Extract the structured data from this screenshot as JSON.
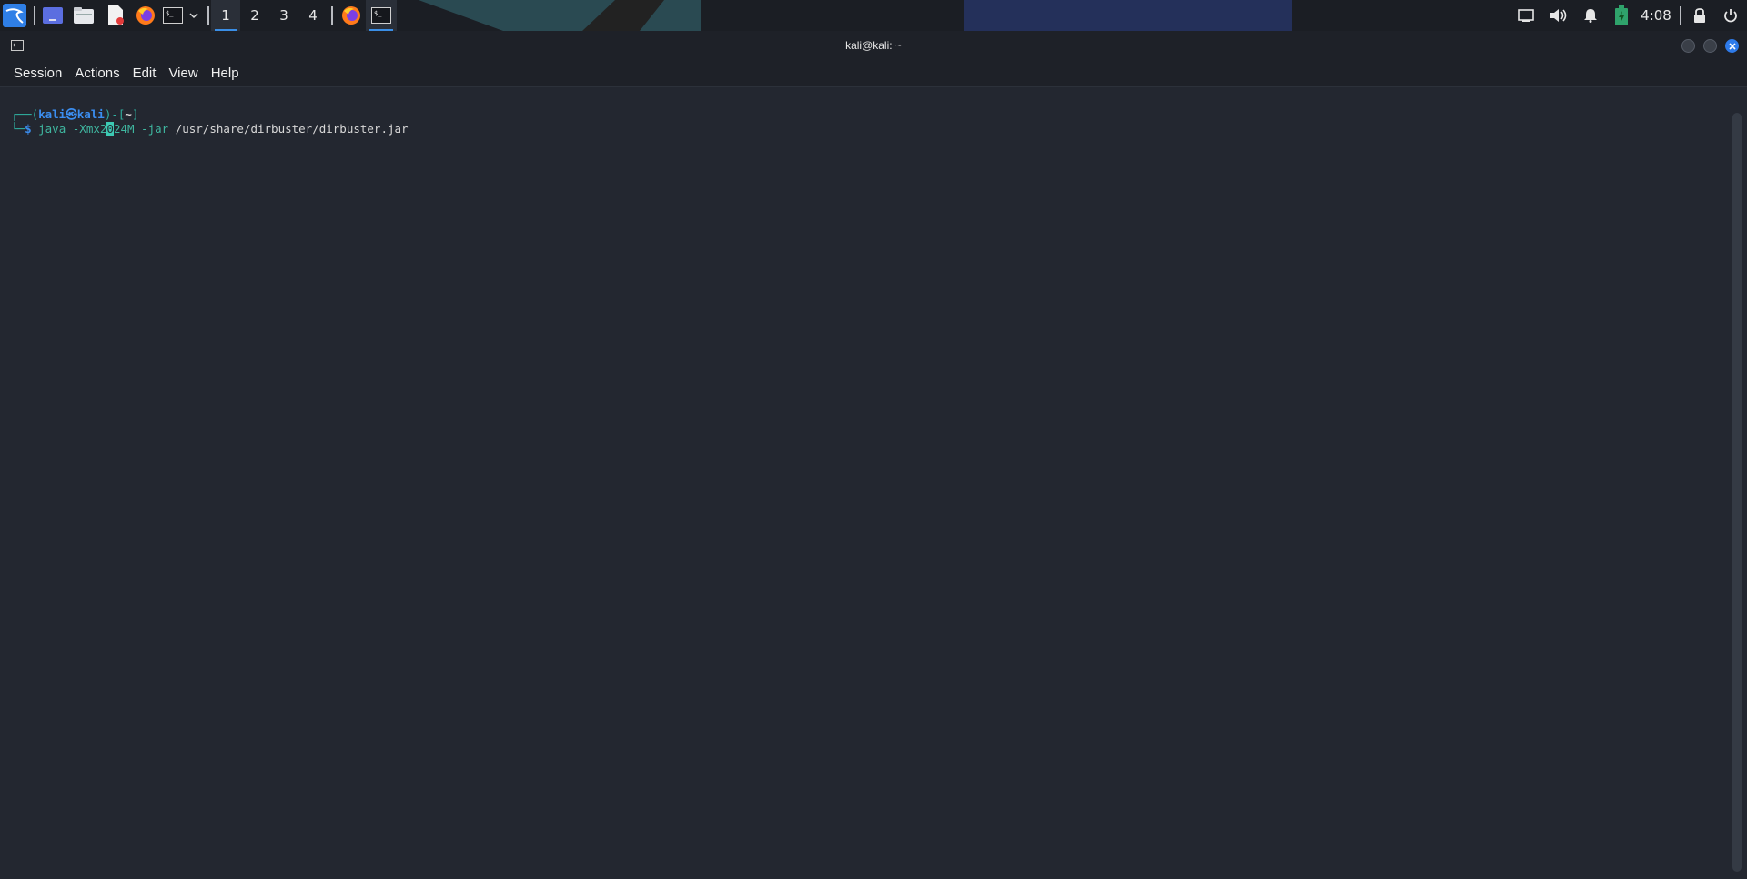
{
  "taskbar": {
    "workspaces": [
      "1",
      "2",
      "3",
      "4"
    ],
    "active_workspace": "1",
    "clock": "4:08",
    "launchers": [
      "kali-menu-icon",
      "desktop-icon",
      "file-manager-icon",
      "text-editor-icon",
      "firefox-icon",
      "terminal-icon"
    ],
    "open_windows": [
      "firefox-icon",
      "terminal-icon"
    ]
  },
  "window": {
    "title": "kali@kali: ~",
    "menu": [
      "Session",
      "Actions",
      "Edit",
      "View",
      "Help"
    ]
  },
  "terminal": {
    "prompt_line_prefix": "┌──(",
    "prompt_user": "kali",
    "prompt_at": "㉿",
    "prompt_host": "kali",
    "prompt_mid": ")-[",
    "prompt_dir": "~",
    "prompt_end": "]",
    "cmd_prefix": "└─",
    "cmd_dollar": "$",
    "cmd_program": "java",
    "cmd_arg1_a": "-Xmx2",
    "cmd_cursor_char": "0",
    "cmd_arg1_b": "24M",
    "cmd_arg2": "-jar",
    "cmd_path": "/usr/share/dirbuster/dirbuster.jar"
  },
  "colors": {
    "accent": "#3a8ee6",
    "terminal_bg": "#232730",
    "prompt_teal": "#2fb0a0",
    "prompt_blue": "#3b8ef0"
  }
}
